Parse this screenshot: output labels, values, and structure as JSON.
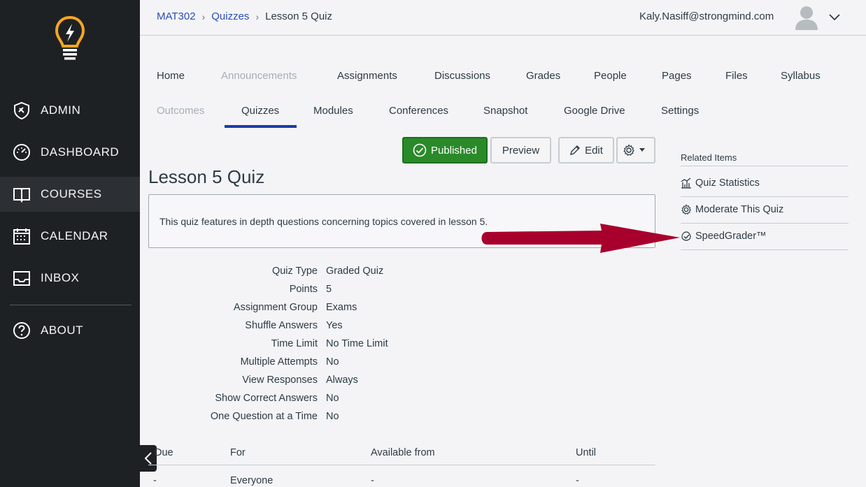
{
  "sidebar": {
    "items": [
      {
        "label": "ADMIN",
        "icon": "shield-icon"
      },
      {
        "label": "DASHBOARD",
        "icon": "gauge-icon"
      },
      {
        "label": "COURSES",
        "icon": "book-icon"
      },
      {
        "label": "CALENDAR",
        "icon": "calendar-icon"
      },
      {
        "label": "INBOX",
        "icon": "inbox-icon"
      },
      {
        "label": "ABOUT",
        "icon": "question-icon"
      }
    ]
  },
  "breadcrumb": {
    "course": "MAT302",
    "section": "Quizzes",
    "current": "Lesson 5 Quiz"
  },
  "user": {
    "email": "Kaly.Nasiff@strongmind.com"
  },
  "course_nav": {
    "row1": [
      "Home",
      "Announcements",
      "Assignments",
      "Discussions",
      "Grades",
      "People",
      "Pages",
      "Files",
      "Syllabus"
    ],
    "row2": [
      "Outcomes",
      "Quizzes",
      "Modules",
      "Conferences",
      "Snapshot",
      "Google Drive",
      "Settings"
    ]
  },
  "toolbar": {
    "published_label": "Published",
    "preview_label": "Preview",
    "edit_label": "Edit"
  },
  "quiz": {
    "title": "Lesson 5 Quiz",
    "description": "This quiz features in depth questions concerning topics covered in lesson 5.",
    "details": [
      {
        "k": "Quiz Type",
        "v": "Graded Quiz"
      },
      {
        "k": "Points",
        "v": "5"
      },
      {
        "k": "Assignment Group",
        "v": "Exams"
      },
      {
        "k": "Shuffle Answers",
        "v": "Yes"
      },
      {
        "k": "Time Limit",
        "v": "No Time Limit"
      },
      {
        "k": "Multiple Attempts",
        "v": "No"
      },
      {
        "k": "View Responses",
        "v": "Always"
      },
      {
        "k": "Show Correct Answers",
        "v": "No"
      },
      {
        "k": "One Question at a Time",
        "v": "No"
      }
    ]
  },
  "availability": {
    "headers": [
      "Due",
      "For",
      "Available from",
      "Until"
    ],
    "row": [
      "-",
      "Everyone",
      "-",
      "-"
    ]
  },
  "related": {
    "heading": "Related Items",
    "items": [
      "Quiz Statistics",
      "Moderate This Quiz",
      "SpeedGrader™"
    ]
  },
  "colors": {
    "sidebar_bg": "#1e2124",
    "accent": "#1a3aa6",
    "published": "#2a8a2a",
    "arrow": "#a8002c",
    "logo": "#f5a623"
  }
}
